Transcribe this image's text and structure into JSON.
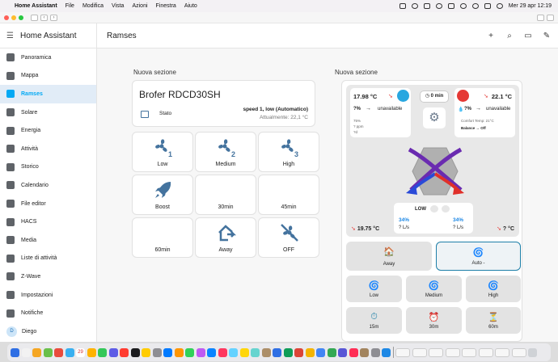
{
  "menubar": {
    "app": "Home Assistant",
    "items": [
      "File",
      "Modifica",
      "Vista",
      "Azioni",
      "Finestra",
      "Aiuto"
    ],
    "clock": "Mer 29 apr  12:19"
  },
  "sidebar": {
    "title": "Home Assistant",
    "items": [
      {
        "label": "Panoramica",
        "icon": "view-dashboard-icon"
      },
      {
        "label": "Mappa",
        "icon": "map-icon"
      },
      {
        "label": "Ramses",
        "icon": "fan-icon",
        "active": true
      },
      {
        "label": "Solare",
        "icon": "solar-icon"
      },
      {
        "label": "Energia",
        "icon": "lightning-icon"
      },
      {
        "label": "Attività",
        "icon": "list-icon"
      },
      {
        "label": "Storico",
        "icon": "chart-icon"
      },
      {
        "label": "Calendario",
        "icon": "calendar-icon"
      },
      {
        "label": "File editor",
        "icon": "wrench-icon"
      },
      {
        "label": "HACS",
        "icon": "hacs-icon"
      },
      {
        "label": "Media",
        "icon": "play-icon"
      },
      {
        "label": "Liste di attività",
        "icon": "clipboard-icon"
      },
      {
        "label": "Z-Wave",
        "icon": "zwave-icon"
      },
      {
        "label": "Impostazioni",
        "icon": "gear-icon"
      },
      {
        "label": "Notifiche",
        "icon": "bell-icon"
      }
    ],
    "user": {
      "initial": "D",
      "name": "Diego"
    }
  },
  "header": {
    "title": "Ramses"
  },
  "left_section": {
    "title": "Nuova sezione",
    "entity": {
      "name": "Brofer RDCD30SH",
      "row_label": "Stato",
      "state": "speed 1, low (Automatico)",
      "sub": "Attualmente: 22,1 °C"
    },
    "buttons": [
      {
        "label": "Low",
        "icon": "fan-speed-1-icon"
      },
      {
        "label": "Medium",
        "icon": "fan-speed-2-icon"
      },
      {
        "label": "High",
        "icon": "fan-speed-3-icon"
      },
      {
        "label": "Boost",
        "icon": "rocket-icon"
      },
      {
        "label": "30min",
        "icon": ""
      },
      {
        "label": "45min",
        "icon": ""
      },
      {
        "label": "60min",
        "icon": ""
      },
      {
        "label": "Away",
        "icon": "home-export-icon"
      },
      {
        "label": "OFF",
        "icon": "fan-off-icon"
      }
    ]
  },
  "right_section": {
    "title": "Nuova sezione",
    "outdoor": {
      "temp": "17.98 °C",
      "hum": "?%",
      "status": "unavailable",
      "l1": "75%",
      "l2": "? ppm",
      "l3": "?d"
    },
    "timer": "0 min",
    "indoor": {
      "temp": "22.1 °C",
      "hum": "?%",
      "status": "unavailable",
      "comfort": "Comfort Temp: 21°C",
      "balance": "Balance → Off"
    },
    "fan_mode": "LOW",
    "left_pct": "34%",
    "left_flow": "? L/s",
    "right_pct": "34%",
    "right_flow": "? L/s",
    "left_temp": "19.75 °C",
    "right_temp": "? °C",
    "buttons": [
      {
        "label": "Away",
        "icon": "house-icon"
      },
      {
        "label": "Auto -",
        "icon": "spiral-icon"
      },
      {
        "label": "Low",
        "icon": "spiral-icon"
      },
      {
        "label": "Medium",
        "icon": "spiral-icon"
      },
      {
        "label": "High",
        "icon": "spiral-icon"
      },
      {
        "label": "15m",
        "icon": "stopwatch-icon"
      },
      {
        "label": "30m",
        "icon": "alarm-clock-icon"
      },
      {
        "label": "60m",
        "icon": "hourglass-icon"
      }
    ]
  },
  "dock": {
    "badge": "29"
  },
  "colors": {
    "accent": "#03a9f4",
    "icon_blue": "#44739e",
    "arrow_blue": "#2a4ad8",
    "arrow_red": "#e0302a",
    "purple": "#6a2bb0"
  }
}
